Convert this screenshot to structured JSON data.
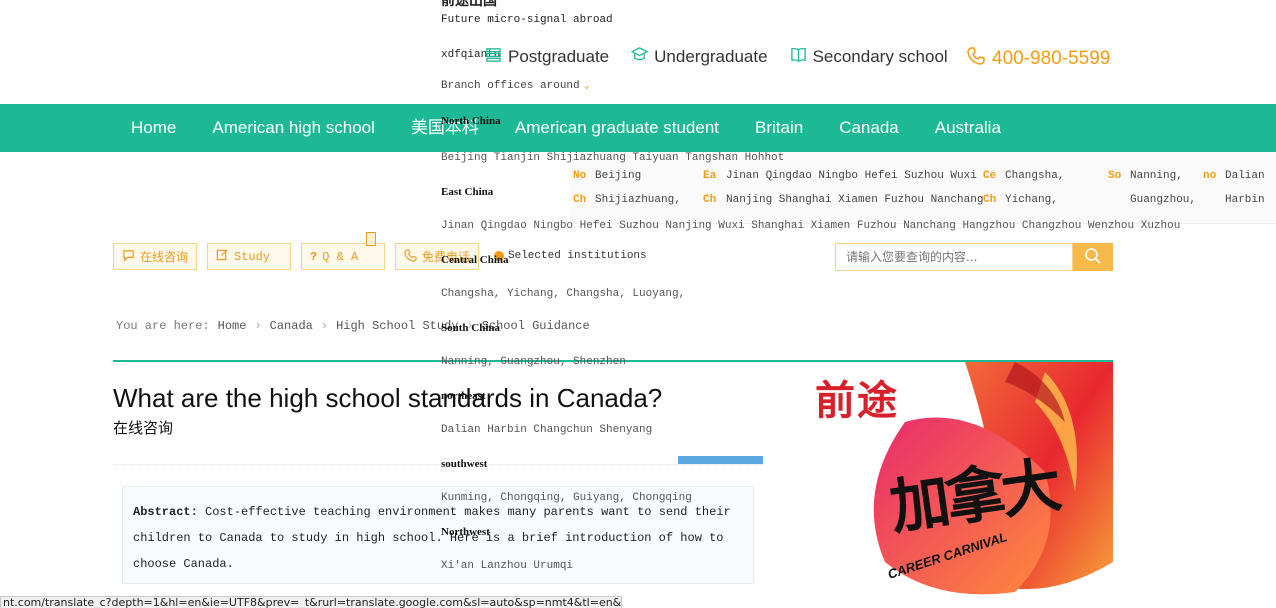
{
  "header": {
    "slogan": "Future micro-signal abroad",
    "wechat_id": "xdfqiantu",
    "edu_links": [
      "Postgraduate",
      "Undergraduate",
      "Secondary school"
    ],
    "phone": "400-980-5599",
    "branch_label": "Branch offices around"
  },
  "nav": {
    "items": [
      "Home",
      "American high school",
      "美国本科",
      "American graduate student",
      "Britain",
      "Canada",
      "Australia"
    ]
  },
  "dropdown": {
    "regions": [
      {
        "name": "North China",
        "cities": "Beijing Tianjin Shijiazhuang Taiyuan Tangshan Hohhot"
      },
      {
        "name": "East China",
        "cities": "Jinan Qingdao Ningbo Hefei Suzhou Nanjing Wuxi Shanghai Xiamen Fuzhou Nanchang Hangzhou Changzhou Wenzhou Xuzhou"
      },
      {
        "name": "Central China",
        "cities": "Changsha, Yichang, Changsha, Luoyang,"
      },
      {
        "name": "South China",
        "cities": "Nanning, Guangzhou, Shenzhen"
      },
      {
        "name": "northeast",
        "cities": "Dalian Harbin Changchun Shenyang"
      },
      {
        "name": "southwest",
        "cities": "Kunming, Chongqing, Guiyang, Chongqing"
      },
      {
        "name": "Northwest",
        "cities": "Xi'an Lanzhou Urumqi"
      }
    ]
  },
  "citygrid": {
    "row1": [
      {
        "tag": "No",
        "text": "Beijing"
      },
      {
        "tag": "Ea",
        "text": "Jinan Qingdao Ningbo Hefei Suzhou Wuxi"
      },
      {
        "tag": "Ce",
        "text": "Changsha,"
      },
      {
        "tag": "So",
        "text": "Nanning,"
      },
      {
        "tag": "no",
        "text": "Dalian"
      }
    ],
    "row2": [
      {
        "tag": "Ch",
        "text": "Shijiazhuang,"
      },
      {
        "tag": "Ch",
        "text": "Nanjing Shanghai Xiamen Fuzhou Nanchang"
      },
      {
        "tag": "Ch",
        "text": "Yichang,"
      },
      {
        "tag": "",
        "text": "Guangzhou,"
      },
      {
        "tag": "",
        "text": "Harbin"
      }
    ]
  },
  "toolbar": {
    "buttons": [
      "在线咨询",
      "Study",
      "Q & A",
      "免费电话"
    ],
    "selected_institutions": "Selected institutions",
    "search_placeholder": "请输入您要查询的内容..."
  },
  "breadcrumb": {
    "prefix": "You are here:",
    "items": [
      "Home",
      "Canada",
      "High School Study",
      "School Guidance"
    ]
  },
  "article": {
    "title": "What are the high school standards in Canada?",
    "online_consult": "在线咨询",
    "abstract_label": "Abstract:",
    "abstract_text": "Cost-effective teaching environment makes many parents want to send their children to Canada to study in high school. Here is a brief introduction of how to choose Canada."
  },
  "poster": {
    "top_text": "前途",
    "main_text": "加拿大",
    "sub_text": "CAREER CARNIVAL"
  },
  "statusbar": {
    "url": "nt.com/translate_c?depth=1&hl=en&ie=UTF8&prev=_t&rurl=translate.google.com&sl=auto&sp=nmt4&tl=en&u=h"
  },
  "colors": {
    "brand_green": "#1db996",
    "accent_orange": "#f39c12",
    "button_bg": "#fff9ec"
  }
}
